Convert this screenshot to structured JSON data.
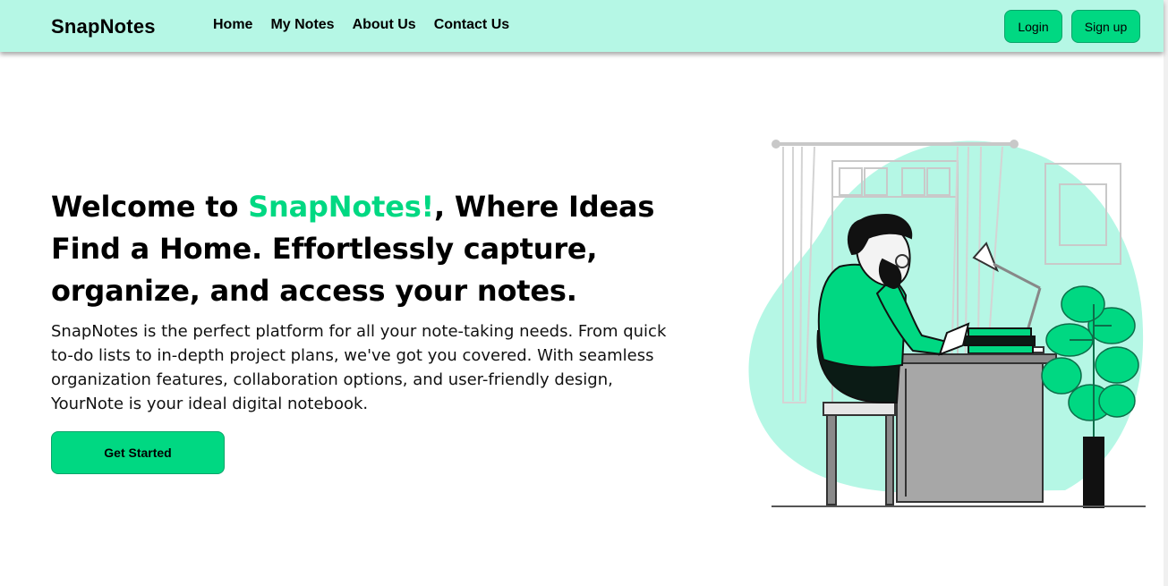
{
  "nav": {
    "brand": "SnapNotes",
    "links": [
      "Home",
      "My Notes",
      "About Us",
      "Contact Us"
    ],
    "login_label": "Login",
    "signup_label": "Sign up"
  },
  "hero": {
    "title_before": "Welcome to ",
    "title_accent": "SnapNotes!",
    "title_after": ", Where Ideas Find a Home. Effortlessly capture, organize, and access your notes.",
    "description": "SnapNotes is the perfect platform for all your note-taking needs. From quick to-do lists to in-depth project plans, we've got you covered. With seamless organization features, collaboration options, and user-friendly design, YourNote is your ideal digital notebook.",
    "cta_label": "Get Started"
  },
  "colors": {
    "navbar_bg": "#b5f7e5",
    "accent": "#00d882",
    "blob": "#b5f7e5"
  },
  "illustration": {
    "icon": "person-reading-at-desk-illustration"
  }
}
